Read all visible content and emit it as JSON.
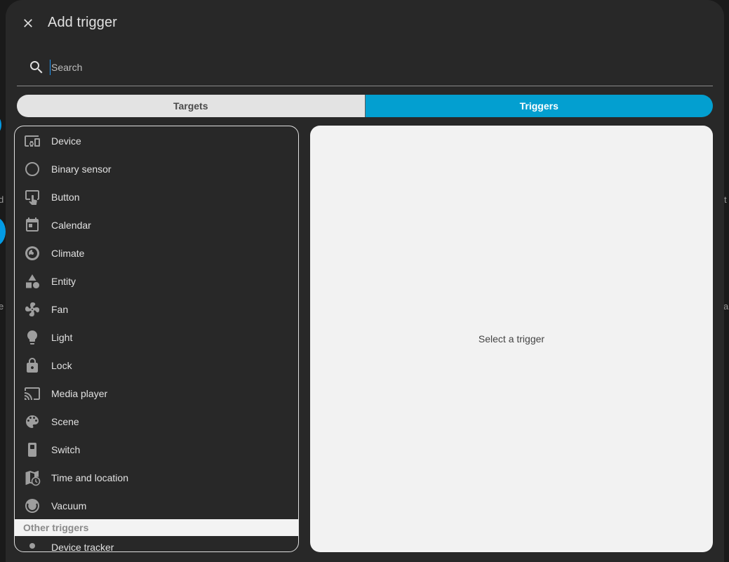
{
  "header": {
    "title": "Add trigger"
  },
  "search": {
    "placeholder": "Search"
  },
  "tabs": [
    {
      "label": "Targets",
      "active": false
    },
    {
      "label": "Triggers",
      "active": true
    }
  ],
  "list": {
    "items": [
      {
        "label": "Device",
        "icon": "device-icon"
      },
      {
        "label": "Binary sensor",
        "icon": "circle-outline-icon"
      },
      {
        "label": "Button",
        "icon": "button-pointer-icon"
      },
      {
        "label": "Calendar",
        "icon": "calendar-icon"
      },
      {
        "label": "Climate",
        "icon": "thermostat-icon"
      },
      {
        "label": "Entity",
        "icon": "shapes-icon"
      },
      {
        "label": "Fan",
        "icon": "fan-icon"
      },
      {
        "label": "Light",
        "icon": "lightbulb-icon"
      },
      {
        "label": "Lock",
        "icon": "lock-icon"
      },
      {
        "label": "Media player",
        "icon": "cast-icon"
      },
      {
        "label": "Scene",
        "icon": "palette-icon"
      },
      {
        "label": "Switch",
        "icon": "switch-icon"
      },
      {
        "label": "Time and location",
        "icon": "map-clock-icon"
      },
      {
        "label": "Vacuum",
        "icon": "robot-vacuum-icon"
      }
    ],
    "section_header": "Other triggers",
    "partial_item": "Device tracker"
  },
  "detail": {
    "empty_text": "Select a trigger"
  },
  "colors": {
    "accent": "#039fd0",
    "dialog_bg": "#282828",
    "panel_bg": "#f2f2f2"
  }
}
